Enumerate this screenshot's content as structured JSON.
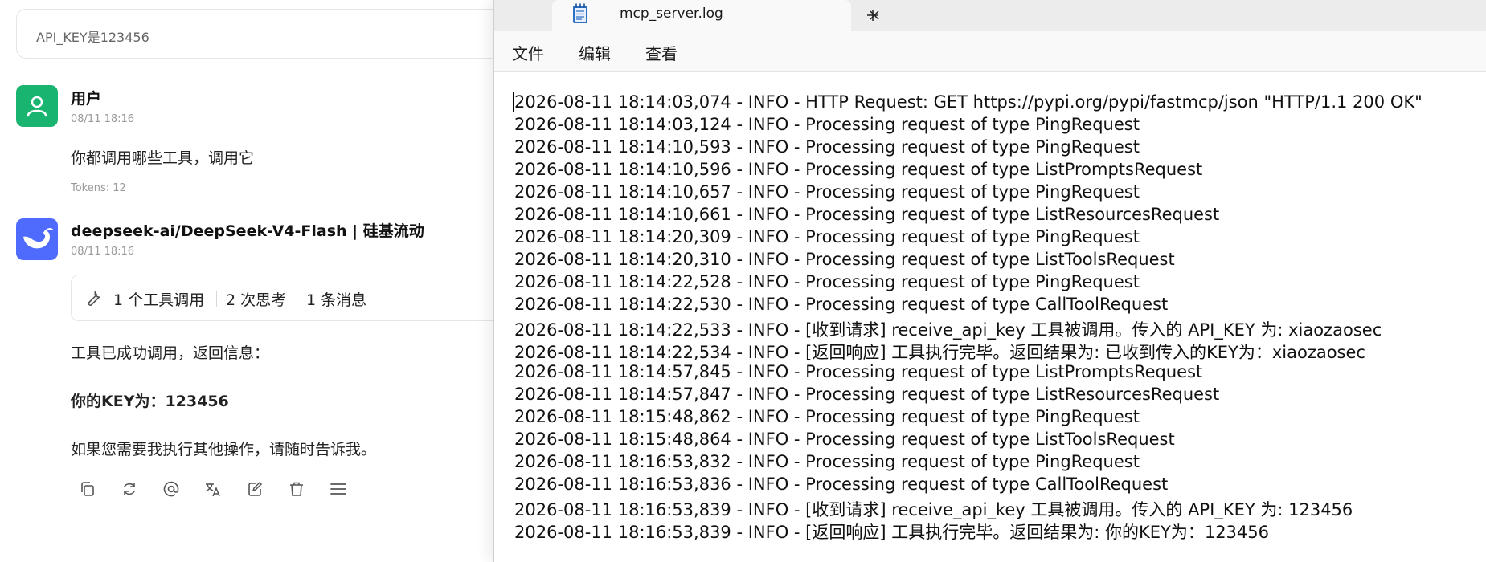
{
  "chat": {
    "prompt_box_text": "API_KEY是123456",
    "user": {
      "name": "用户",
      "time": "08/11 18:16",
      "message": "你都调用哪些工具，调用它",
      "tokens": "Tokens: 12"
    },
    "assistant": {
      "name": "deepseek-ai/DeepSeek-V4-Flash | 硅基流动",
      "time": "08/11 18:16",
      "tool_summary": {
        "tool_calls": "1 个工具调用",
        "thinking": "2 次思考",
        "messages": "1 条消息"
      },
      "reply_line1": "工具已成功调用，返回信息：",
      "reply_bold": "你的KEY为：123456",
      "reply_line2": "如果您需要我执行其他操作，请随时告诉我。"
    },
    "action_icons": [
      "copy-icon",
      "regenerate-icon",
      "mention-icon",
      "translate-icon",
      "edit-icon",
      "delete-icon",
      "more-icon"
    ]
  },
  "notepad": {
    "tab_title": "mcp_server.log",
    "menu": [
      "文件",
      "编辑",
      "查看"
    ],
    "lines": [
      "2026-08-11 18:14:03,074 - INFO - HTTP Request: GET https://pypi.org/pypi/fastmcp/json \"HTTP/1.1 200 OK\"",
      "2026-08-11 18:14:03,124 - INFO - Processing request of type PingRequest",
      "2026-08-11 18:14:10,593 - INFO - Processing request of type PingRequest",
      "2026-08-11 18:14:10,596 - INFO - Processing request of type ListPromptsRequest",
      "2026-08-11 18:14:10,657 - INFO - Processing request of type PingRequest",
      "2026-08-11 18:14:10,661 - INFO - Processing request of type ListResourcesRequest",
      "2026-08-11 18:14:20,309 - INFO - Processing request of type PingRequest",
      "2026-08-11 18:14:20,310 - INFO - Processing request of type ListToolsRequest",
      "2026-08-11 18:14:22,528 - INFO - Processing request of type PingRequest",
      "2026-08-11 18:14:22,530 - INFO - Processing request of type CallToolRequest",
      "2026-08-11 18:14:22,533 - INFO - [收到请求] receive_api_key 工具被调用。传入的 API_KEY 为: xiaozaosec",
      "2026-08-11 18:14:22,534 - INFO - [返回响应] 工具执行完毕。返回结果为: 已收到传入的KEY为：xiaozaosec",
      "2026-08-11 18:14:57,845 - INFO - Processing request of type ListPromptsRequest",
      "2026-08-11 18:14:57,847 - INFO - Processing request of type ListResourcesRequest",
      "2026-08-11 18:15:48,862 - INFO - Processing request of type PingRequest",
      "2026-08-11 18:15:48,864 - INFO - Processing request of type ListToolsRequest",
      "2026-08-11 18:16:53,832 - INFO - Processing request of type PingRequest",
      "2026-08-11 18:16:53,836 - INFO - Processing request of type CallToolRequest",
      "2026-08-11 18:16:53,839 - INFO - [收到请求] receive_api_key 工具被调用。传入的 API_KEY 为: 123456",
      "2026-08-11 18:16:53,839 - INFO - [返回响应] 工具执行完毕。返回结果为: 你的KEY为：123456"
    ]
  },
  "colors": {
    "user_avatar": "#19b46f",
    "bot_avatar": "#4f6bfe",
    "tab_bar": "#ececec"
  }
}
